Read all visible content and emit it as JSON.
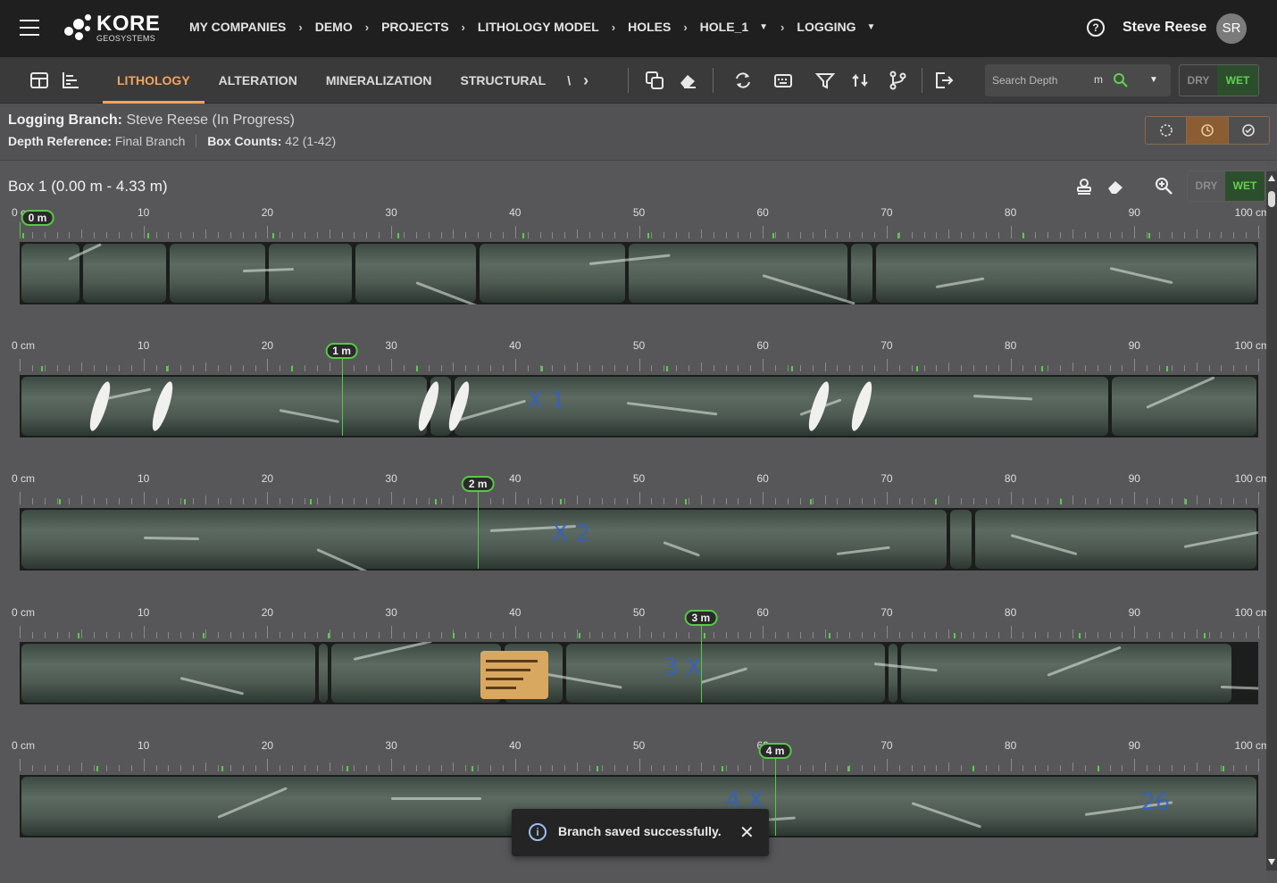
{
  "header": {
    "logo_word": "KORE",
    "logo_sub": "GEOSYSTEMS",
    "breadcrumbs": [
      "MY COMPANIES",
      "DEMO",
      "PROJECTS",
      "LITHOLOGY MODEL",
      "HOLES",
      "HOLE_1",
      "LOGGING"
    ],
    "user_name": "Steve Reese",
    "user_initials": "SR",
    "help_glyph": "?"
  },
  "toolbar": {
    "tabs": [
      "LITHOLOGY",
      "ALTERATION",
      "MINERALIZATION",
      "STRUCTURAL"
    ],
    "tab_overflow": "\\",
    "next_glyph": "›",
    "search_placeholder": "Search Depth",
    "search_unit": "m",
    "dry_label": "DRY",
    "wet_label": "WET",
    "icons": [
      "table-icon",
      "chart-icon",
      "copy-icon",
      "eraser-icon",
      "refresh-icon",
      "keyboard-icon",
      "filter-icon",
      "sync-icon",
      "branch-icon",
      "export-icon"
    ]
  },
  "info": {
    "branch_label": "Logging Branch:",
    "branch_value": "Steve Reese  (In Progress)",
    "depth_ref_label": "Depth Reference:",
    "depth_ref_value": "Final Branch",
    "box_counts_label": "Box Counts:",
    "box_counts_value": "42 (1-42)",
    "status": "in-progress"
  },
  "box": {
    "title": "Box 1 (0.00 m - 4.33 m)",
    "dry_label": "DRY",
    "wet_label": "WET"
  },
  "ruler_labels": [
    "0 cm",
    "10",
    "20",
    "30",
    "40",
    "50",
    "60",
    "70",
    "80",
    "90",
    "100 cm"
  ],
  "depth_markers": [
    {
      "label": "0 m",
      "row": 0,
      "at_cm": 0
    },
    {
      "label": "1 m",
      "row": 1,
      "at_cm": 26
    },
    {
      "label": "2 m",
      "row": 2,
      "at_cm": 37
    },
    {
      "label": "3 m",
      "row": 3,
      "at_cm": 55
    },
    {
      "label": "4 m",
      "row": 4,
      "at_cm": 61
    }
  ],
  "handwriting": [
    "X 1",
    "X 2",
    "3 X",
    "4 X",
    "26"
  ],
  "toast": {
    "message": "Branch saved successfully.",
    "close_glyph": "✕",
    "info_glyph": "i"
  },
  "colors": {
    "accent": "#f3a35d",
    "marker_green": "#58c848",
    "wet_green": "#5fd34a"
  }
}
